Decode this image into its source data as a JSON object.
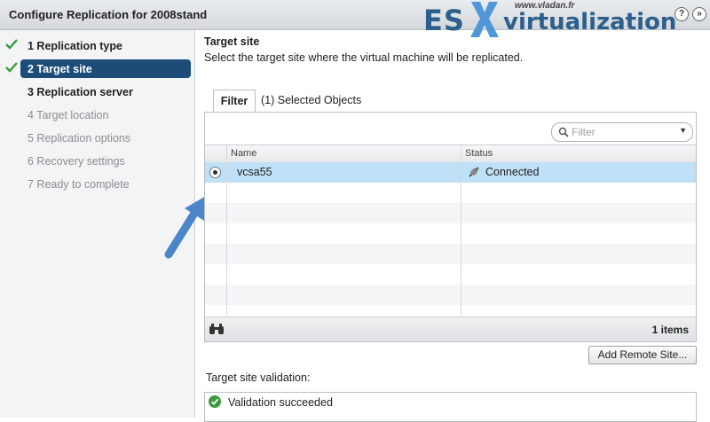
{
  "window": {
    "title": "Configure Replication for 2008stand",
    "help_label": "?",
    "expand_label": "»"
  },
  "logo": {
    "es": "ES",
    "virtualization": "virtualization",
    "url": "www.vladan.fr"
  },
  "steps": [
    {
      "label": "1  Replication type",
      "state": "done"
    },
    {
      "label": "2  Target site",
      "state": "active"
    },
    {
      "label": "3  Replication server",
      "state": "next"
    },
    {
      "label": "4  Target location",
      "state": "pending"
    },
    {
      "label": "5  Replication options",
      "state": "pending"
    },
    {
      "label": "6  Recovery settings",
      "state": "pending"
    },
    {
      "label": "7  Ready to complete",
      "state": "pending"
    }
  ],
  "main": {
    "heading": "Target site",
    "description": "Select the target site where the virtual machine will be replicated.",
    "tabs": [
      {
        "label": "Filter",
        "active": true
      },
      {
        "label": "(1) Selected Objects",
        "active": false
      }
    ],
    "filter": {
      "placeholder": "Filter"
    },
    "table": {
      "columns": [
        "Name",
        "Status"
      ],
      "rows": [
        {
          "name": "vcsa55",
          "status": "Connected",
          "selected": true
        }
      ],
      "count": "1 items"
    },
    "add_remote_site_label": "Add Remote Site...",
    "validation_label": "Target site validation:",
    "validation_message": "Validation succeeded"
  },
  "colors": {
    "accent": "#1e4c78",
    "selected_row": "#bfe0f6",
    "logo": "#2d5f8c",
    "logo_x": "#4f97d6",
    "check": "#3b9a3b",
    "arrow": "#4a86c8"
  }
}
